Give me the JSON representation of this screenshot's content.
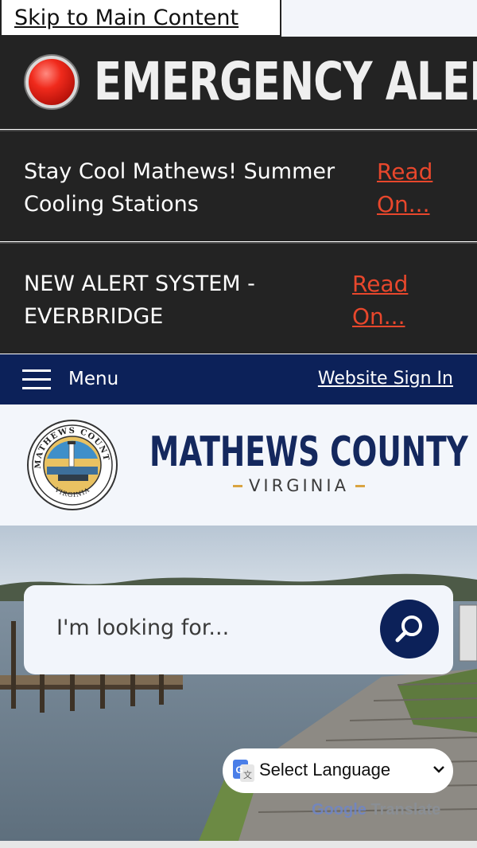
{
  "skip_link": {
    "label": "Skip to Main Content"
  },
  "emergency": {
    "title": "EMERGENCY ALERT",
    "alerts": [
      {
        "text": "Stay Cool Mathews! Summer Cooling Stations",
        "link": "Read On..."
      },
      {
        "text": "NEW ALERT SYSTEM - EVERBRIDGE",
        "link": "Read On..."
      }
    ]
  },
  "nav": {
    "menu_label": "Menu",
    "signin_label": "Website Sign In"
  },
  "branding": {
    "name": "MATHEWS COUNTY",
    "subtitle": "VIRGINIA",
    "seal_top_text": "MATHEWS COUNTY",
    "seal_bottom_text": "VIRGINIA"
  },
  "search": {
    "placeholder": "I'm looking for..."
  },
  "translate": {
    "select_label": "Select Language",
    "powered_google": "Google",
    "powered_translate": "Translate"
  },
  "colors": {
    "navy": "#0c2159",
    "alert_bg": "#232323",
    "read_on": "#e8472c",
    "accent_gold": "#d9a441"
  }
}
